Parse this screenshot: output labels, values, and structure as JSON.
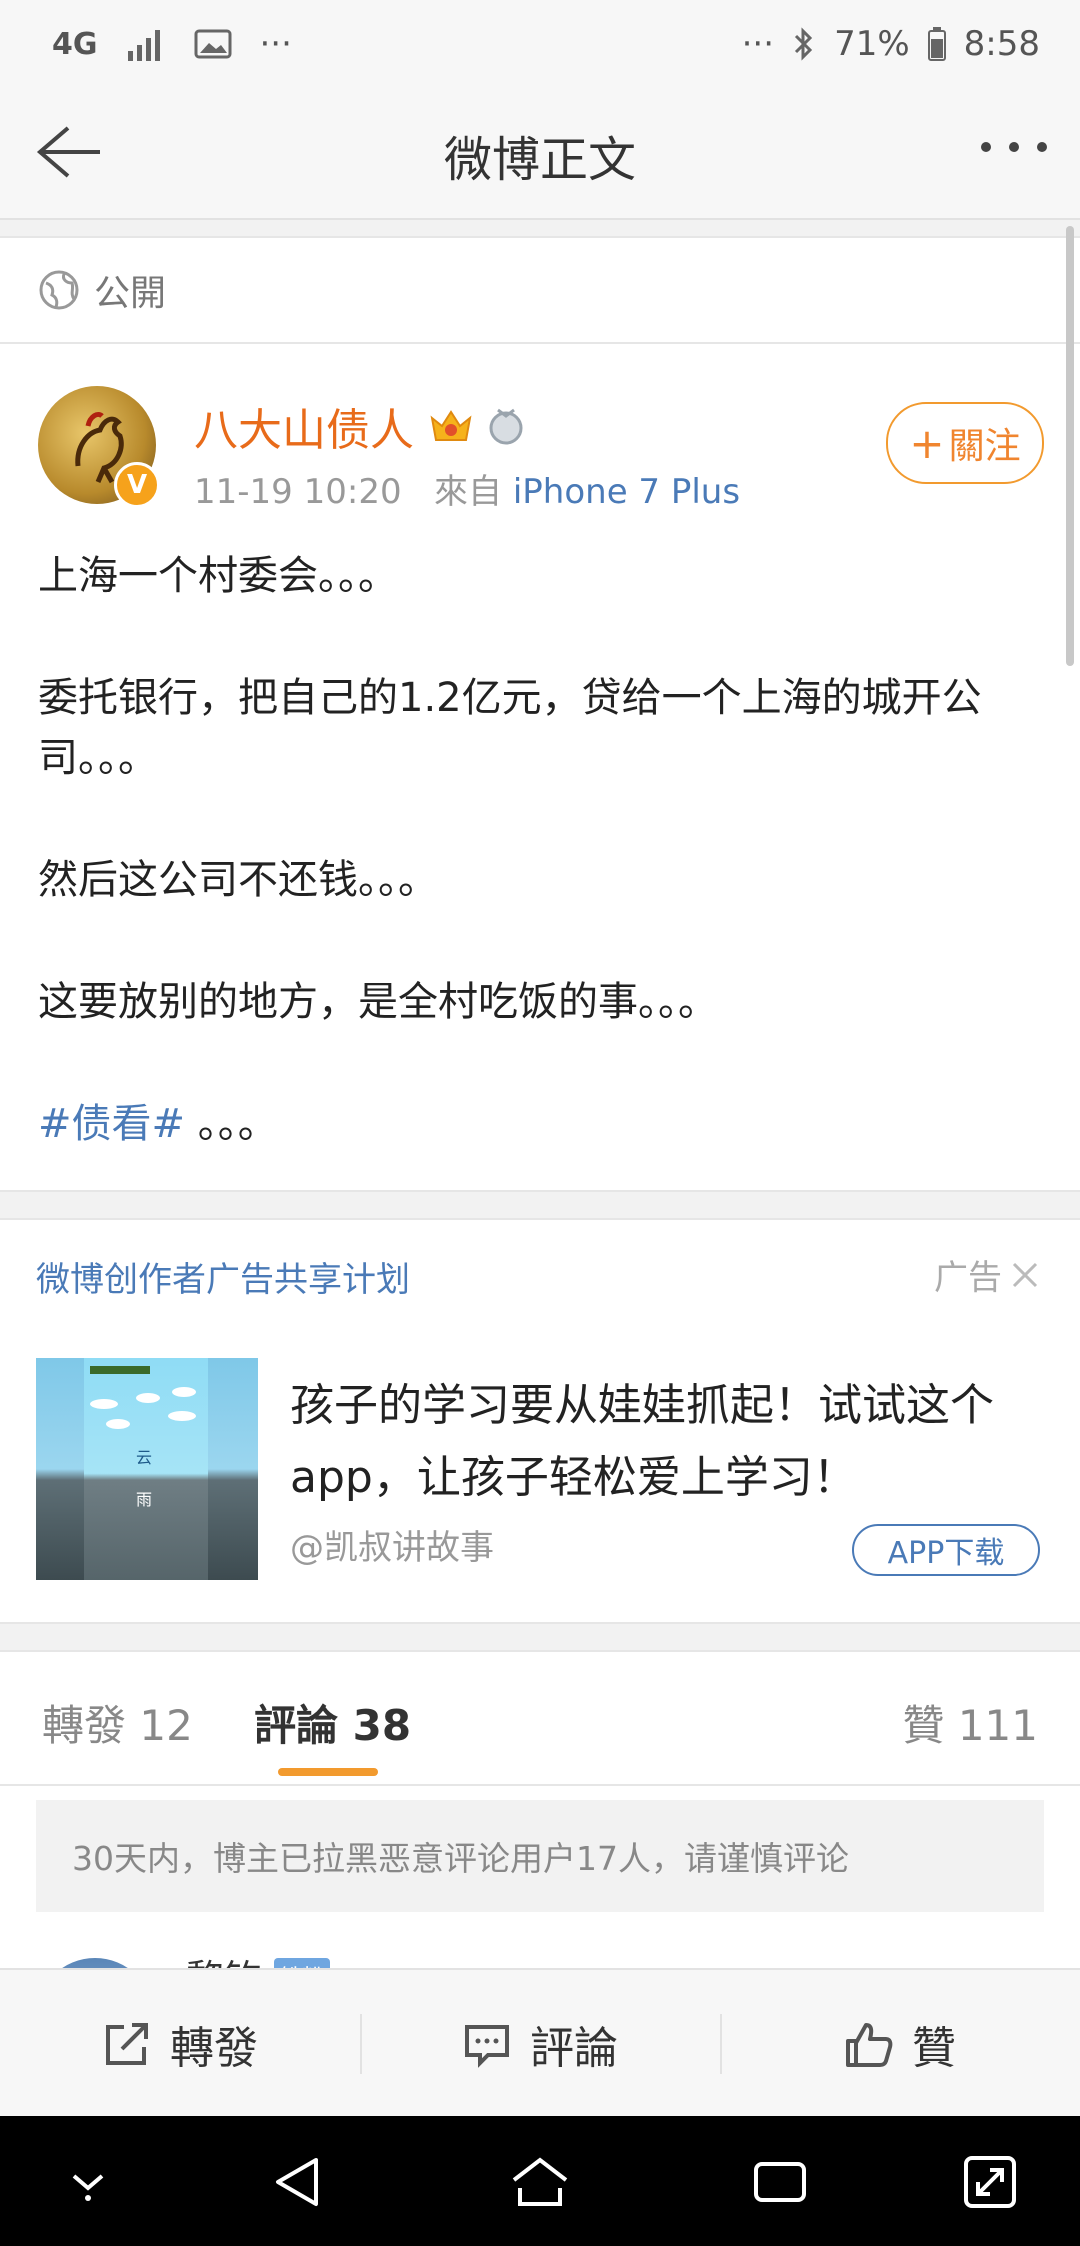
{
  "status_bar": {
    "network": "4G",
    "icons_left": [
      "4g-icon",
      "signal-icon",
      "image-icon",
      "more-dots-icon"
    ],
    "more": "···",
    "battery": "71%",
    "time": "8:58"
  },
  "nav": {
    "title": "微博正文"
  },
  "visibility": {
    "label": "公開"
  },
  "post": {
    "author": "八大山债人",
    "verified_badge": "V",
    "time": "11-19 10:20",
    "source_prefix": "來自",
    "source": "iPhone 7 Plus",
    "follow_label": "关注",
    "follow_plus": "+",
    "follow_text": "關注",
    "paragraphs": [
      "上海一个村委会。。。",
      "委托银行，把自己的1.2亿元，贷给一个上海的城开公司。。。",
      "然后这公司不还钱。。。",
      "这要放别的地方，是全村吃饭的事。。。"
    ],
    "hashtag": "#债看#",
    "hashtag_suffix": " 。。。"
  },
  "ad": {
    "plan": "微博创作者广告共享计划",
    "label": "广告",
    "headline": "孩子的学习要从娃娃抓起！试试这个app，让孩子轻松爱上学习！",
    "handle": "@凯叔讲故事",
    "cta": "APP下载",
    "thumb_text_1": "云",
    "thumb_text_2": "雨"
  },
  "tabs": {
    "repost": "轉發 12",
    "comment": "評論 38",
    "like": "贊 111"
  },
  "notice": "30天内，博主已拉黑恶意评论用户17人，请谨慎评论",
  "first_comment": {
    "name": "黎钧",
    "badge": "铁粉"
  },
  "actions": {
    "repost": "轉發",
    "comment": "評論",
    "like": "贊"
  },
  "colors": {
    "accent_orange": "#f29a2e",
    "link_blue": "#4a7ab7",
    "author_orange": "#e86b1a"
  }
}
